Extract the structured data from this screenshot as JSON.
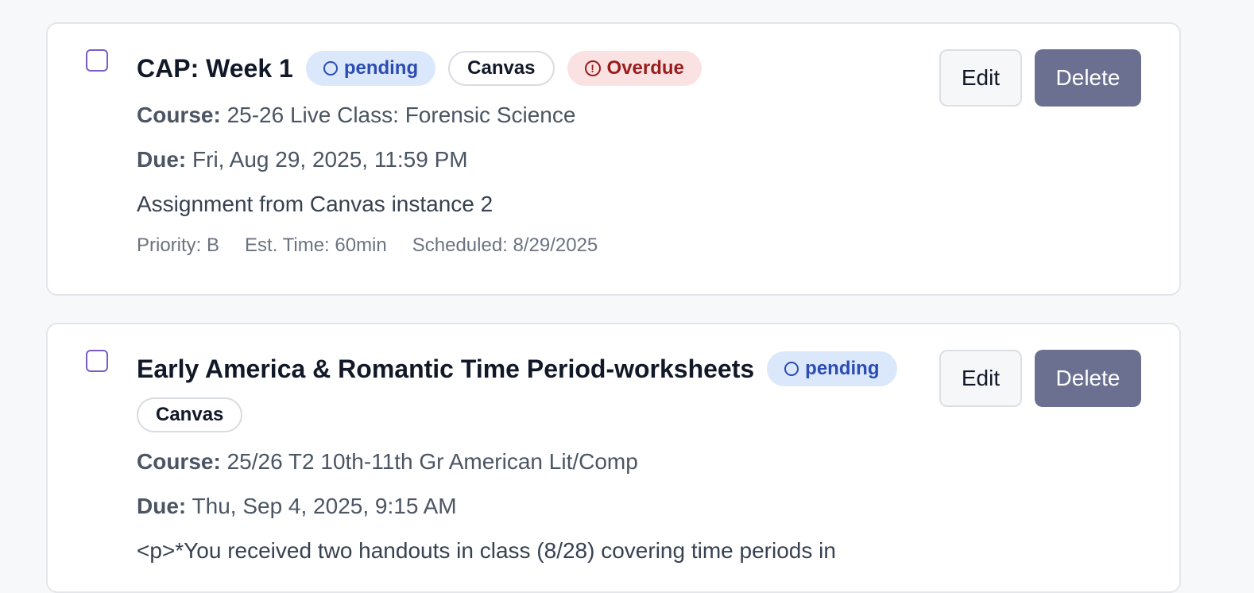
{
  "colors": {
    "pending_bg": "#dbe7fb",
    "pending_text": "#2b4cb1",
    "overdue_bg": "#fbe2e2",
    "overdue_text": "#9b1c1c",
    "delete_bg": "#6b7090",
    "checkbox_border": "#7c5cc4"
  },
  "labels": {
    "course": "Course:",
    "due": "Due:",
    "edit": "Edit",
    "delete": "Delete"
  },
  "assignments": [
    {
      "title": "CAP: Week 1",
      "status": "pending",
      "source": "Canvas",
      "overdue": "Overdue",
      "course": "25-26 Live Class: Forensic Science",
      "due": "Fri, Aug 29, 2025, 11:59 PM",
      "description": "Assignment from Canvas instance 2",
      "priority": "Priority: B",
      "est_time": "Est. Time: 60min",
      "scheduled": "Scheduled: 8/29/2025"
    },
    {
      "title": "Early America & Romantic Time Period-worksheets",
      "status": "pending",
      "source": "Canvas",
      "course": "25/26 T2 10th-11th Gr American Lit/Comp",
      "due": "Thu, Sep 4, 2025, 9:15 AM",
      "description": "<p>*You received two handouts in class (8/28) covering time periods in"
    }
  ]
}
